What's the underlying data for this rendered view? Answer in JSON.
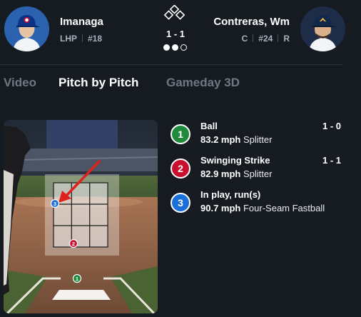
{
  "header": {
    "pitcher": {
      "name": "Imanaga",
      "position": "LHP",
      "number": "#18",
      "team_color": "#0e3386"
    },
    "batter": {
      "name": "Contreras, Wm",
      "position": "C",
      "number": "#24",
      "bats": "R",
      "team_color": "#12284b"
    },
    "count": "1 - 1",
    "outs": {
      "filled": 2,
      "total": 3
    },
    "bases_occupied": []
  },
  "tabs": [
    {
      "label": "Video",
      "active": false
    },
    {
      "label": "Pitch by Pitch",
      "active": true
    },
    {
      "label": "Gameday 3D",
      "active": false
    }
  ],
  "pitches": [
    {
      "number": "1",
      "result": "Ball",
      "count": "1 - 0",
      "speed": "83.2 mph",
      "type": "Splitter",
      "color": "#1e8a3a"
    },
    {
      "number": "2",
      "result": "Swinging Strike",
      "count": "1 - 1",
      "speed": "82.9 mph",
      "type": "Splitter",
      "color": "#c8102e"
    },
    {
      "number": "3",
      "result": "In play, run(s)",
      "count": "",
      "speed": "90.7 mph",
      "type": "Four-Seam Fastball",
      "color": "#1a6fd8"
    }
  ],
  "colors": {
    "background": "#161b22",
    "annotation_arrow": "#e0201c"
  }
}
